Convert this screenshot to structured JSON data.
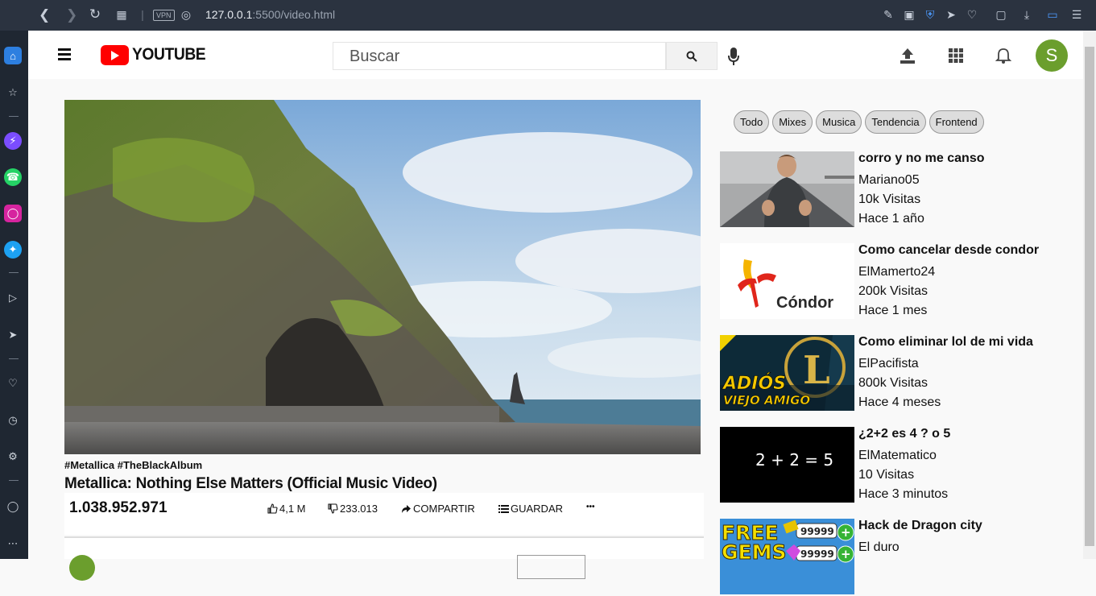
{
  "browser": {
    "url_host": "127.0.0.1",
    "url_path": ":5500/video.html",
    "vpn_label": "VPN"
  },
  "header": {
    "logo_text": "YOUTUBE",
    "search_placeholder": "Buscar",
    "avatar_letter": "S",
    "avatar_color": "#6b9e2d"
  },
  "video": {
    "tags": "#Metallica #TheBlackAlbum",
    "title": "Metallica: Nothing Else Matters (Official Music Video)",
    "views": "1.038.952.971",
    "likes": "4,1 M",
    "dislikes": "233.013",
    "share_label": "COMPARTIR",
    "save_label": "GUARDAR",
    "more_label": "•••"
  },
  "chips": [
    "Todo",
    "Mixes",
    "Musica",
    "Tendencia",
    "Frontend"
  ],
  "recommendations": [
    {
      "title": "corro y no me canso",
      "channel": "Mariano05",
      "views": "10k Visitas",
      "age": "Hace 1 año"
    },
    {
      "title": "Como cancelar desde condor",
      "channel": "ElMamerto24",
      "views": "200k Visitas",
      "age": "Hace 1 mes"
    },
    {
      "title": "Como eliminar lol de mi vida",
      "channel": "ElPacifista",
      "views": "800k Visitas",
      "age": "Hace 4 meses"
    },
    {
      "title": "¿2+2 es 4 ? o 5",
      "channel": "ElMatematico",
      "views": "10 Visitas",
      "age": "Hace 3 minutos"
    },
    {
      "title": "Hack de Dragon city",
      "channel": "El duro",
      "views": "",
      "age": ""
    }
  ],
  "thumb_text": {
    "condor": "Cóndor",
    "lol_line1": "ADIÓS",
    "lol_line2": "VIEJO AMIGO",
    "lol_letter": "L",
    "math": "2 + 2 = 5",
    "gems1": "FREE",
    "gems2": "GEMS",
    "gems_count": "99999"
  },
  "colors": {
    "youtube_red": "#ff0000",
    "browser_bar": "#2b3340",
    "sidebar": "#1f2732"
  }
}
